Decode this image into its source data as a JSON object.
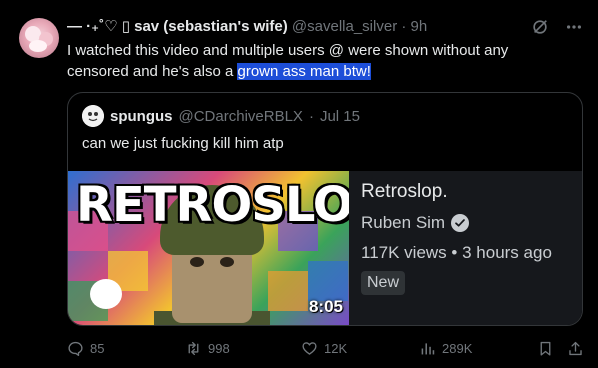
{
  "post": {
    "display_name": "— ·₊˚♡ ▯ sav (sebastian's wife)",
    "handle": "@savella_silver",
    "separator": "·",
    "time": "9h",
    "text_plain": "I watched this video and multiple users @ were shown without any censored and he's also a ",
    "text_highlighted": "grown ass man btw!"
  },
  "quote": {
    "display_name": "spungus",
    "handle": "@CDarchiveRBLX",
    "separator": "·",
    "time": "Jul 15",
    "text": "can we just fucking kill him atp"
  },
  "video": {
    "thumbnail_text": "RETROSLOP",
    "duration": "8:05",
    "title": "Retroslop.",
    "channel": "Ruben Sim",
    "views": "117K views",
    "separator": "•",
    "age": "3 hours ago",
    "badge": "New"
  },
  "actions": {
    "replies": "85",
    "reposts": "998",
    "likes": "12K",
    "views": "289K"
  },
  "icons": {
    "grok": "grok-icon",
    "more": "more-icon",
    "reply": "reply-icon",
    "repost": "repost-icon",
    "like": "heart-icon",
    "views": "views-icon",
    "bookmark": "bookmark-icon",
    "share": "share-icon"
  },
  "colors": {
    "background": "#000000",
    "text": "#e7e9ea",
    "muted": "#71767b",
    "highlight": "#1d4ed8",
    "border": "#333639"
  }
}
